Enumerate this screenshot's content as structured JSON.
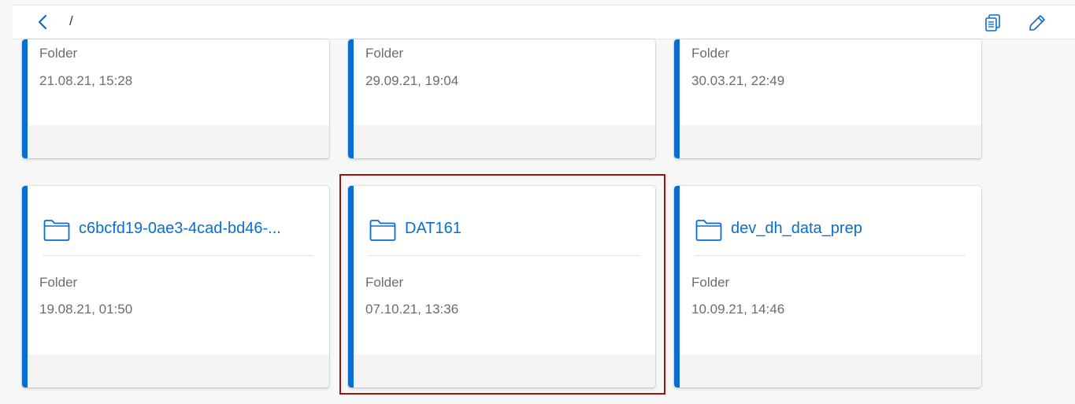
{
  "toolbar": {
    "path": "/",
    "back_icon": "chevron-left-icon",
    "copy_icon": "copy-icon",
    "edit_icon": "pencil-icon"
  },
  "colors": {
    "accent": "#0a6ed1",
    "link": "#0a6ed1",
    "highlight": "#a50f0f"
  },
  "cards_top": [
    {
      "type": "Folder",
      "date": "21.08.21, 15:28"
    },
    {
      "type": "Folder",
      "date": "29.09.21, 19:04"
    },
    {
      "type": "Folder",
      "date": "30.03.21, 22:49"
    }
  ],
  "cards_bottom": [
    {
      "name": "c6bcfd19-0ae3-4cad-bd46-...",
      "type": "Folder",
      "date": "19.08.21, 01:50"
    },
    {
      "name": "DAT161",
      "type": "Folder",
      "date": "07.10.21, 13:36"
    },
    {
      "name": "dev_dh_data_prep",
      "type": "Folder",
      "date": "10.09.21, 14:46"
    }
  ]
}
